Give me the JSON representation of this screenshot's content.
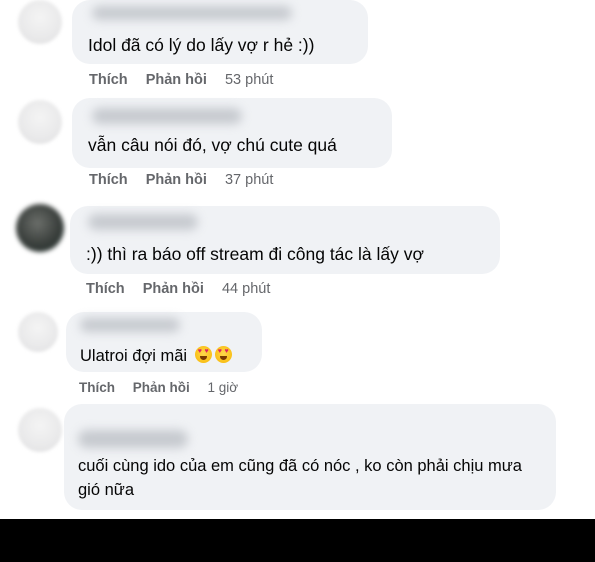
{
  "comments": [
    {
      "text": "Idol đã có lý do lấy vợ r hẻ :))",
      "actions": {
        "like": "Thích",
        "reply": "Phản hồi",
        "time": "53 phút"
      }
    },
    {
      "text": "vẫn câu nói đó, vợ chú cute quá",
      "actions": {
        "like": "Thích",
        "reply": "Phản hồi",
        "time": "37 phút"
      }
    },
    {
      "text": ":)) thì ra báo off stream đi công tác là lấy vợ",
      "actions": {
        "like": "Thích",
        "reply": "Phản hồi",
        "time": "44 phút"
      }
    },
    {
      "text": "Ulatroi đợi mãi",
      "emojis": [
        "heart-eyes-emoji",
        "heart-eyes-emoji"
      ],
      "actions": {
        "like": "Thích",
        "reply": "Phản hồi",
        "time": "1 giờ"
      }
    },
    {
      "text": "cuối cùng ido của em cũng đã có nóc , ko còn phải chịu mưa gió nữa"
    }
  ],
  "colors": {
    "bubble": "#f0f2f5",
    "action_text": "#65676b",
    "text": "#050505"
  }
}
